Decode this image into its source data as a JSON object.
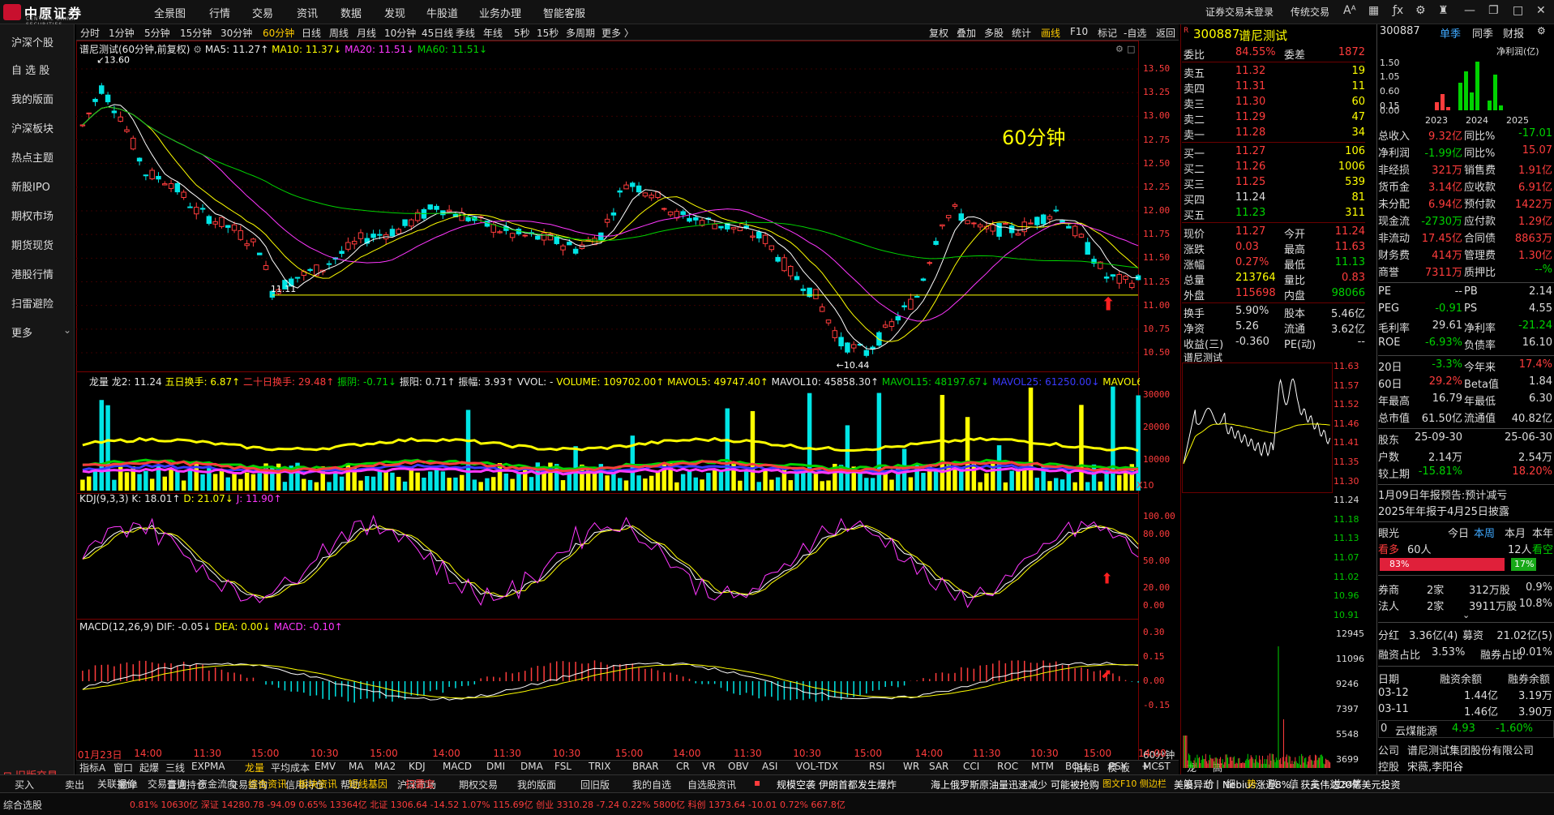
{
  "app": {
    "logo_text": "中原证券",
    "logo_sub": "CENTRAL CHINA SECURITIES"
  },
  "top_menu": [
    "全景图",
    "行情",
    "交易",
    "资讯",
    "数据",
    "发现",
    "牛股道",
    "业务办理",
    "智能客服"
  ],
  "top_right": {
    "login": "证券交易未登录",
    "theme": "传统交易",
    "font": "AA"
  },
  "sidebar": [
    "沪深个股",
    "自 选 股",
    "我的版面",
    "沪深板块",
    "热点主题",
    "新股IPO",
    "期权市场",
    "期货现货",
    "港股行情",
    "扫雷避险",
    "更多"
  ],
  "sidebar_bottom": "旧版交易",
  "period_tabs": [
    "分时",
    "1分钟",
    "5分钟",
    "15分钟",
    "30分钟",
    "60分钟",
    "日线",
    "周线",
    "月线",
    "10分钟",
    "45日线",
    "季线",
    "年线",
    "5秒",
    "15秒",
    "多周期",
    "更多 〉"
  ],
  "period_active": "60分钟",
  "tool_tabs": [
    "复权",
    "叠加",
    "多股",
    "统计",
    "画线",
    "F10",
    "标记",
    "-自选",
    "返回"
  ],
  "chart_title": {
    "name": "谱尼测试(60分钟,前复权)",
    "ma5": "MA5: 11.27↑",
    "ma10": "MA10: 11.37↓",
    "ma20": "MA20: 11.51↓",
    "ma60": "MA60: 11.51↓"
  },
  "chart_overlay": "60分钟",
  "price_axis": [
    "13.50",
    "13.25",
    "13.00",
    "12.75",
    "12.50",
    "12.25",
    "12.00",
    "11.75",
    "11.50",
    "11.25",
    "11.00",
    "10.75",
    "10.50"
  ],
  "high_label": "13.60",
  "low_label": "10.44",
  "support_label": "11.11",
  "vol_legend": {
    "a": "龙量",
    "b": "龙2: 11.24",
    "c": "五日换手: 6.87↑",
    "d": "二十日换手: 29.48↑",
    "e": "振阴: -0.71↓",
    "f": "振阳: 0.71↑",
    "g": "振幅: 3.93↑",
    "h": "VVOL: -",
    "i": "VOLUME: 109702.00↑",
    "j": "MAVOL5: 49747.40↑",
    "k": "MAVOL10: 45858.30↑",
    "l": "MAVOL15: 48197.67↓",
    "m": "MAVOL25: 61250.00↓",
    "n": "MAVOL60: 5"
  },
  "vol_axis": [
    "30000",
    "20000",
    "10000"
  ],
  "vol_unit": "X10",
  "kdj_legend": {
    "a": "KDJ(9,3,3)",
    "k": "K: 18.01↑",
    "d": "D: 21.07↓",
    "j": "J: 11.90↑"
  },
  "kdj_axis": [
    "100.00",
    "80.00",
    "50.00",
    "20.00",
    "0.00"
  ],
  "macd_legend": {
    "a": "MACD(12,26,9)",
    "dif": "DIF: -0.05↓",
    "dea": "DEA: 0.00↓",
    "macd": "MACD: -0.10↑"
  },
  "macd_axis": [
    "0.30",
    "0.15",
    "0.00",
    "-0.15"
  ],
  "time_axis": [
    "01月23日",
    "14:00",
    "11:30",
    "15:00",
    "10:30",
    "15:00",
    "14:00",
    "11:30",
    "10:30",
    "15:00",
    "14:00",
    "11:30",
    "10:30",
    "15:00",
    "14:00",
    "11:30",
    "10:30",
    "15:00",
    "14:00"
  ],
  "time_unit": "60分钟",
  "indicator_tabs": [
    "指标A",
    "窗口",
    "起爆",
    "三线",
    "EXPMA",
    "龙量",
    "平均成本",
    "EMV",
    "MA",
    "MA2",
    "KDJ",
    "MACD",
    "DMI",
    "DMA",
    "FSL",
    "TRIX",
    "BRAR",
    "CR",
    "VR",
    "OBV",
    "ASI",
    "VOL-TDX",
    "RSI",
    "WR",
    "SAR",
    "CCI",
    "ROC",
    "MTM",
    "BOLL",
    "PSY",
    "MCST",
    "龙线",
    "高低",
    "指标B",
    "模 板",
    "+",
    "-"
  ],
  "stock": {
    "code": "300887",
    "name": "谱尼测试"
  },
  "orderbook": {
    "webi": {
      "label": "委比",
      "pct": "84.55%",
      "diff_label": "委差",
      "diff": "1872"
    },
    "sell": [
      {
        "l": "卖五",
        "p": "11.32",
        "v": "19"
      },
      {
        "l": "卖四",
        "p": "11.31",
        "v": "11"
      },
      {
        "l": "卖三",
        "p": "11.30",
        "v": "60"
      },
      {
        "l": "卖二",
        "p": "11.29",
        "v": "47"
      },
      {
        "l": "卖一",
        "p": "11.28",
        "v": "34"
      }
    ],
    "buy": [
      {
        "l": "买一",
        "p": "11.27",
        "v": "106"
      },
      {
        "l": "买二",
        "p": "11.26",
        "v": "1006"
      },
      {
        "l": "买三",
        "p": "11.25",
        "v": "539"
      },
      {
        "l": "买四",
        "p": "11.24",
        "v": "81"
      },
      {
        "l": "买五",
        "p": "11.23",
        "v": "311"
      }
    ],
    "quote": [
      {
        "a": "现价",
        "b": "11.27",
        "c": "今开",
        "d": "11.24"
      },
      {
        "a": "涨跌",
        "b": "0.03",
        "c": "最高",
        "d": "11.63"
      },
      {
        "a": "涨幅",
        "b": "0.27%",
        "c": "最低",
        "d": "11.13"
      },
      {
        "a": "总量",
        "b": "213764",
        "c": "量比",
        "d": "0.83"
      },
      {
        "a": "外盘",
        "b": "115698",
        "c": "内盘",
        "d": "98066"
      },
      {
        "a": "换手",
        "b": "5.90%",
        "c": "股本",
        "d": "5.46亿"
      },
      {
        "a": "净资",
        "b": "5.26",
        "c": "流通",
        "d": "3.62亿"
      },
      {
        "a": "收益(三)",
        "b": "-0.360",
        "c": "PE(动)",
        "d": "--"
      }
    ]
  },
  "mini_chart": {
    "title": "谱尼测试",
    "axis": [
      "11.63",
      "11.57",
      "11.52",
      "11.46",
      "11.41",
      "11.35",
      "11.30",
      "11.24",
      "11.18",
      "11.13",
      "11.07",
      "11.02",
      "10.96",
      "10.91"
    ],
    "vol_axis": [
      "12945",
      "11096",
      "9246",
      "7397",
      "5548",
      "3699",
      "1849"
    ]
  },
  "right_panel": {
    "header": {
      "code": "300887",
      "tabs": [
        "单季",
        "同季",
        "财报"
      ],
      "chart_title": "净利润(亿)"
    },
    "profit_axis": [
      "1.50",
      "1.05",
      "0.60",
      "0.15",
      "0.00"
    ],
    "years": [
      "2023",
      "2024",
      "2025"
    ],
    "fin": [
      [
        "总收入",
        "9.32亿",
        "同比%",
        "-17.01"
      ],
      [
        "净利润",
        "-1.99亿",
        "同比%",
        "15.07"
      ],
      [
        "非经损",
        "321万",
        "销售费",
        "1.91亿"
      ],
      [
        "货币金",
        "3.14亿",
        "应收款",
        "6.91亿"
      ],
      [
        "未分配",
        "6.94亿",
        "预付款",
        "1422万"
      ],
      [
        "现金流",
        "-2730万",
        "应付款",
        "1.29亿"
      ],
      [
        "非流动",
        "17.45亿",
        "合同债",
        "8863万"
      ],
      [
        "财务费",
        "414万",
        "管理费",
        "1.30亿"
      ],
      [
        "商誉",
        "7311万",
        "质押比",
        "--%"
      ]
    ],
    "val": [
      [
        "PE",
        "--",
        "PB",
        "2.14"
      ],
      [
        "PEG",
        "-0.91",
        "PS",
        "4.55"
      ],
      [
        "毛利率",
        "29.61",
        "净利率",
        "-21.24"
      ],
      [
        "ROE",
        "-6.93%",
        "负债率",
        "16.10"
      ]
    ],
    "perf": [
      [
        "20日",
        "-3.3%",
        "今年来",
        "17.4%"
      ],
      [
        "60日",
        "29.2%",
        "Beta值",
        "1.84"
      ],
      [
        "年最高",
        "16.79",
        "年最低",
        "6.30"
      ],
      [
        "总市值",
        "61.50亿",
        "流通值",
        "40.82亿"
      ]
    ],
    "holders": [
      [
        "股东",
        "25-09-30",
        "25-06-30"
      ],
      [
        "户数",
        "2.14万",
        "2.54万"
      ],
      [
        "较上期",
        "-15.81%",
        "18.20%"
      ]
    ],
    "notice1": "1月09日年报预告:预计减亏",
    "notice2": "2025年年报于4月25日披露",
    "eye": {
      "label": "眼光",
      "today": "今日",
      "week": "本周",
      "month": "本月",
      "year": "本年",
      "bull": "看多",
      "bull_n": "60人",
      "bear_n": "12人",
      "bear": "看空",
      "bull_pct": "83%",
      "bear_pct": "17%",
      "bull_frac": 0.83
    },
    "inst": [
      [
        "券商",
        "2家",
        "312万股",
        "0.9%"
      ],
      [
        "法人",
        "2家",
        "3911万股",
        "10.8%"
      ]
    ],
    "div": [
      [
        "分红",
        "3.36亿(4)",
        "募资",
        "21.02亿(5)"
      ],
      [
        "融资占比",
        "3.53%",
        "融券占比",
        "0.01%"
      ]
    ],
    "margin_head": [
      "日期",
      "融资余额",
      "融券余额"
    ],
    "margin": [
      [
        "03-12",
        "1.44亿",
        "3.19万"
      ],
      [
        "03-11",
        "1.46亿",
        "3.90万"
      ]
    ],
    "sector": {
      "idx": "0",
      "name": "云煤能源",
      "price": "4.93",
      "chg": "-1.60%"
    },
    "company": [
      "公司",
      "谱尼测试集团股份有限公司"
    ],
    "control": [
      "控股",
      "宋薇,李阳谷"
    ]
  },
  "bottom_bar": {
    "items": [
      "买入",
      "卖出",
      "撤单",
      "普通持仓",
      "交易查询",
      "信用持仓",
      "帮助",
      "沪深市场",
      "期权交易",
      "我的版面",
      "回旧版",
      "我的自选",
      "自选股资讯"
    ],
    "ticker": "规模空袭 伊朗首都发生爆炸",
    "news1": "海上俄罗斯原油量迅速减少 可能被抢购",
    "news2": "美股异动丨Nebius涨近8%，获英伟达20亿美元投资",
    "rightlinks": "图文F10 侧边栏",
    "tabs2": [
      "关联报价",
      "交易查询",
      "资金流向",
      "综合资讯",
      "板块资讯",
      "短线基因",
      "扫雷宝"
    ],
    "status": "综合选股",
    "mini_tabs": [
      "笔",
      "价",
      "细",
      "势",
      "联",
      "值",
      "主",
      "逆",
      "筹"
    ],
    "status_row": "0.81%  10630亿  深证 14280.78  -94.09  0.65%  13364亿  北证 1306.64  -14.52  1.07%  115.69亿  创业 3310.28  -7.24  0.22%  5800亿  科创 1373.64  -10.01  0.72%  667.8亿"
  }
}
